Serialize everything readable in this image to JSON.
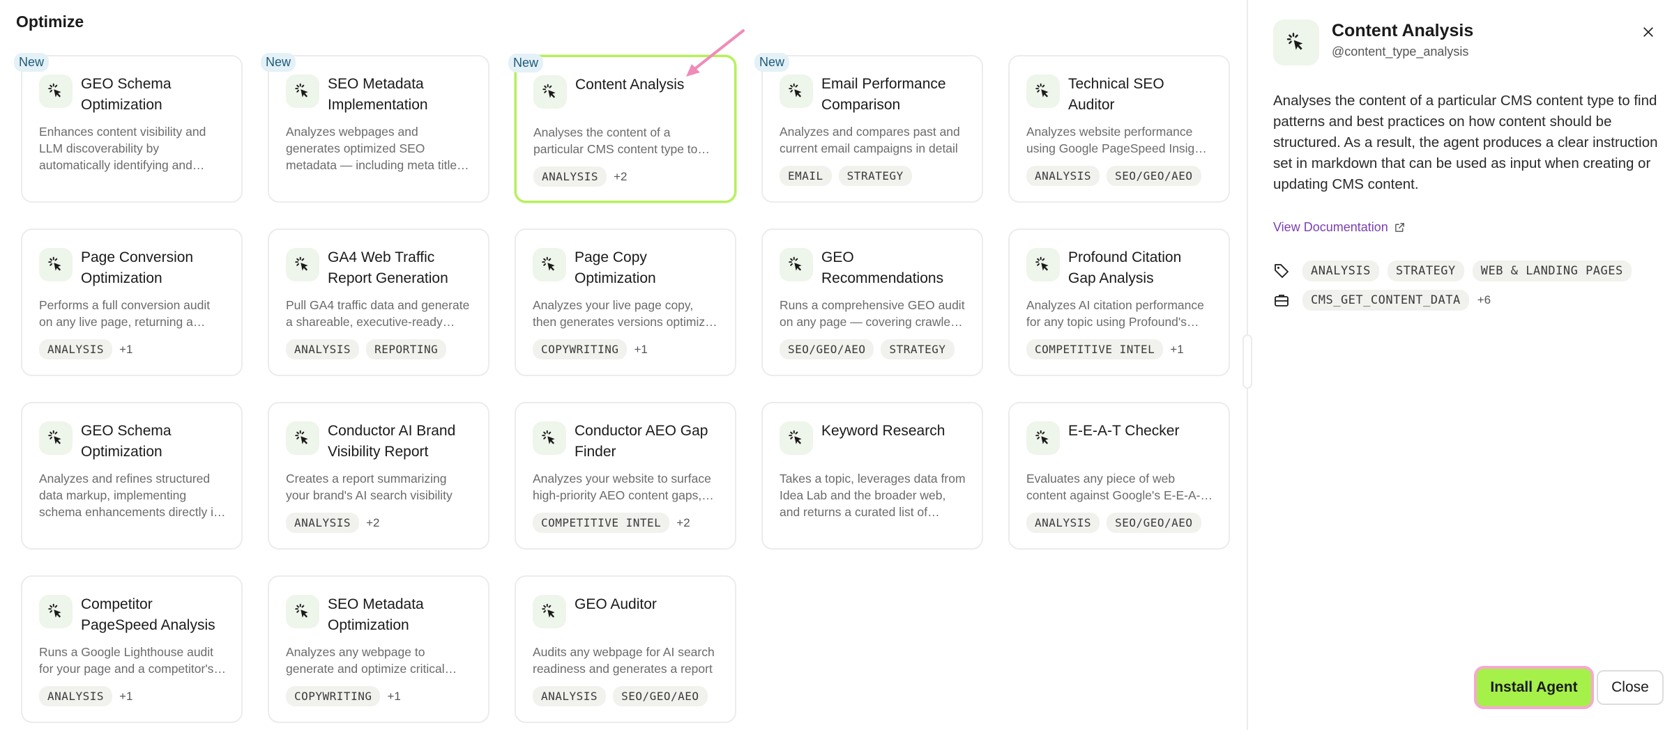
{
  "page": {
    "title": "Optimize"
  },
  "cards": [
    {
      "title": "GEO Schema Optimization",
      "new": "New",
      "desc": "Enhances content visibility and LLM discoverability by automatically identifying and improving schema markup",
      "tags": [],
      "more": ""
    },
    {
      "title": "SEO Metadata Implementation",
      "new": "New",
      "desc": "Analyzes webpages and generates optimized SEO metadata — including meta titles and descriptions",
      "tags": [],
      "more": ""
    },
    {
      "title": "Content Analysis",
      "new": "New",
      "desc": "Analyses the content of a particular CMS content type to find patterns",
      "tags": [
        "ANALYSIS"
      ],
      "more": "+2",
      "selected": true
    },
    {
      "title": "Email Performance Comparison",
      "new": "New",
      "desc": "Analyzes and compares past and current email campaigns in detail",
      "tags": [
        "EMAIL",
        "STRATEGY"
      ],
      "more": ""
    },
    {
      "title": "Technical SEO Auditor",
      "new": "",
      "desc": "Analyzes website performance using Google PageSpeed Insights data",
      "tags": [
        "ANALYSIS",
        "SEO/GEO/AEO"
      ],
      "more": ""
    },
    {
      "title": "Page Conversion Optimization",
      "new": "",
      "desc": "Performs a full conversion audit on any live page, returning a prioritized list",
      "tags": [
        "ANALYSIS"
      ],
      "more": "+1"
    },
    {
      "title": "GA4 Web Traffic Report Generation",
      "new": "",
      "desc": "Pull GA4 traffic data and generate a shareable, executive-ready report",
      "tags": [
        "ANALYSIS",
        "REPORTING"
      ],
      "more": ""
    },
    {
      "title": "Page Copy Optimization",
      "new": "",
      "desc": "Analyzes your live page copy, then generates versions optimized for conversion",
      "tags": [
        "COPYWRITING"
      ],
      "more": "+1"
    },
    {
      "title": "GEO Recommendations",
      "new": "",
      "desc": "Runs a comprehensive GEO audit on any page — covering crawlers and more",
      "tags": [
        "SEO/GEO/AEO",
        "STRATEGY"
      ],
      "more": ""
    },
    {
      "title": "Profound Citation Gap Analysis",
      "new": "",
      "desc": "Analyzes AI citation performance for any topic using Profound's data",
      "tags": [
        "COMPETITIVE INTEL"
      ],
      "more": "+1"
    },
    {
      "title": "GEO Schema Optimization",
      "new": "",
      "desc": "Analyzes and refines structured data markup, implementing schema enhancements directly in your pages",
      "tags": [],
      "more": ""
    },
    {
      "title": "Conductor AI Brand Visibility Report",
      "new": "",
      "desc": "Creates a report summarizing your brand's AI search visibility",
      "tags": [
        "ANALYSIS"
      ],
      "more": "+2"
    },
    {
      "title": "Conductor AEO Gap Finder",
      "new": "",
      "desc": "Analyzes your website to surface high-priority AEO content gaps, ranked",
      "tags": [
        "COMPETITIVE INTEL"
      ],
      "more": "+2"
    },
    {
      "title": "Keyword Research",
      "new": "",
      "desc": "Takes a topic, leverages data from Idea Lab and the broader web, and returns a curated list of keywords to target",
      "tags": [],
      "more": ""
    },
    {
      "title": "E-E-A-T Checker",
      "new": "",
      "desc": "Evaluates any piece of web content against Google's E-E-A-T guidelines",
      "tags": [
        "ANALYSIS",
        "SEO/GEO/AEO"
      ],
      "more": ""
    },
    {
      "title": "Competitor PageSpeed Analysis",
      "new": "",
      "desc": "Runs a Google Lighthouse audit for your page and a competitor's, side by side",
      "tags": [
        "ANALYSIS"
      ],
      "more": "+1"
    },
    {
      "title": "SEO Metadata Optimization",
      "new": "",
      "desc": "Analyzes any webpage to generate and optimize critical SEO metadata",
      "tags": [
        "COPYWRITING"
      ],
      "more": "+1"
    },
    {
      "title": "GEO Auditor",
      "new": "",
      "desc": "Audits any webpage for AI search readiness and generates a report",
      "tags": [
        "ANALYSIS",
        "SEO/GEO/AEO"
      ],
      "more": ""
    }
  ],
  "panel": {
    "title": "Content Analysis",
    "handle": "@content_type_analysis",
    "description": "Analyses the content of a particular CMS content type to find patterns and best practices on how content should be structured. As a result, the agent produces a clear instruction set in markdown that can be used as input when creating or updating CMS content.",
    "doc_link": "View Documentation",
    "tags": [
      "ANALYSIS",
      "STRATEGY",
      "WEB & LANDING PAGES"
    ],
    "tools": [
      "CMS_GET_CONTENT_DATA"
    ],
    "tools_more": "+6",
    "install_label": "Install Agent",
    "close_label": "Close"
  },
  "colors": {
    "accent": "#a6f04a",
    "highlight": "#f7a8d0",
    "link": "#7a3fb0",
    "badge_bg": "#e4f1f7"
  },
  "icons": {
    "agent": "cursor-click-icon",
    "close": "close-icon",
    "external": "external-link-icon",
    "tag": "tag-icon",
    "tools": "toolbox-icon"
  }
}
